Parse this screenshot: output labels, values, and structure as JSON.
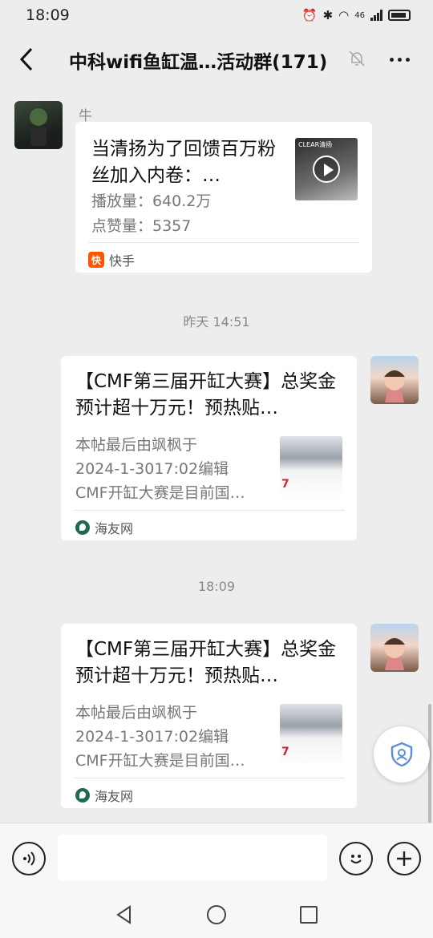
{
  "status_bar": {
    "time": "18:09",
    "network": "46"
  },
  "header": {
    "back_label": "<",
    "title": "中科wifi鱼缸温…活动群(171)"
  },
  "messages": [
    {
      "sender": "牛",
      "card": {
        "title": "当清扬为了回馈百万粉丝加入内卷：…",
        "line1": "播放量：640.2万",
        "line2": "点赞量：5357",
        "source": "快手",
        "source_icon_text": "快",
        "thumb_text": "CLEAR清扬"
      }
    },
    {
      "card": {
        "title": "【CMF第三届开缸大赛】总奖金预计超十万元！预热贴…",
        "line1": "本帖最后由飒枫于",
        "line2": "2024-1-3017:02编辑",
        "line3": "CMF开缸大赛是目前国…",
        "source": "海友网",
        "thumb_text": "7"
      }
    },
    {
      "card": {
        "title": "【CMF第三届开缸大赛】总奖金预计超十万元！预热贴…",
        "line1": "本帖最后由飒枫于",
        "line2": "2024-1-3017:02编辑",
        "line3": "CMF开缸大赛是目前国…",
        "source": "海友网",
        "thumb_text": "7"
      }
    }
  ],
  "timestamps": [
    "昨天 14:51",
    "18:09"
  ],
  "input": {
    "placeholder": ""
  },
  "colors": {
    "background": "#ededed",
    "card": "#ffffff",
    "kuaishou": "#ff5500",
    "haiyou": "#1e6b52"
  }
}
